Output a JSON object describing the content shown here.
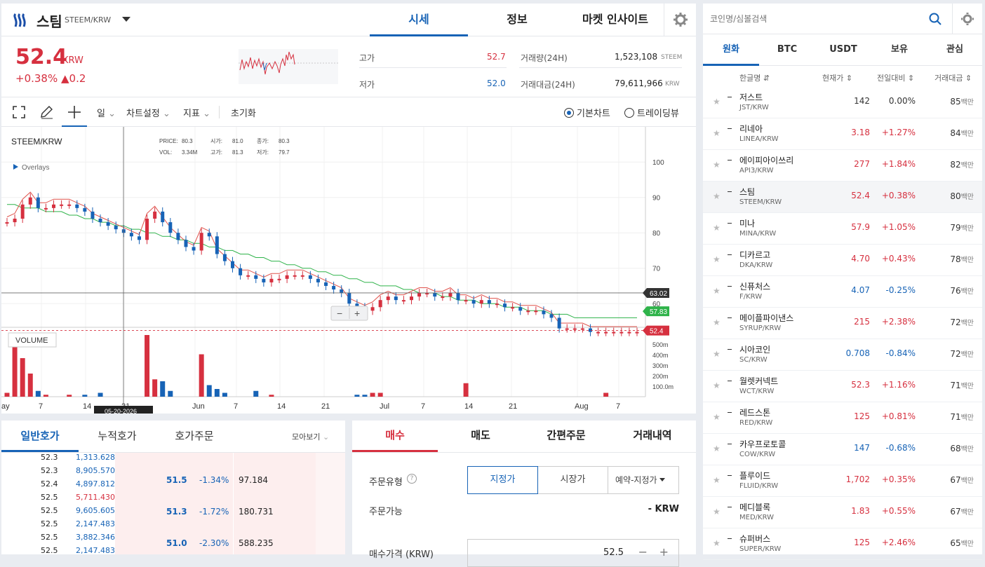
{
  "header": {
    "coin_name": "스팀",
    "pair": "STEEM/KRW",
    "tabs": [
      "시세",
      "정보",
      "마켓 인사이트"
    ]
  },
  "price": {
    "value": "52.4",
    "unit": "KRW",
    "change_pct": "+0.38%",
    "change_abs": "▲0.2",
    "high_label": "고가",
    "high": "52.7",
    "low_label": "저가",
    "low": "52.0",
    "vol_label": "거래량(24H)",
    "vol": "1,523,108",
    "vol_unit": "STEEM",
    "amt_label": "거래대금(24H)",
    "amt": "79,611,966",
    "amt_unit": "KRW"
  },
  "toolbar": {
    "period": "일",
    "settings": "차트설정",
    "indicator": "지표",
    "reset": "초기화",
    "basic_chart": "기본차트",
    "trading_view": "트레이딩뷰"
  },
  "chart_data": {
    "type": "candlestick",
    "title": "STEEM/KRW",
    "overlays_label": "Overlays",
    "info": {
      "PRICE": "80.3",
      "시가": "81.0",
      "종가": "80.3",
      "VOL": "3.34M",
      "고가": "81.3",
      "저가": "79.7"
    },
    "y_ticks": [
      100.0,
      90.0,
      80.0,
      70.0,
      60.0
    ],
    "ylim": [
      50,
      104
    ],
    "vol_ticks": [
      "500m",
      "400m",
      "300m",
      "200m",
      "100.0m"
    ],
    "x_labels": [
      "ay",
      "7",
      "14",
      "21",
      "Jun",
      "7",
      "14",
      "21",
      "Jul",
      "7",
      "14",
      "21",
      "Aug",
      "7"
    ],
    "date_badge": "05-20-2026",
    "volume_label": "VOLUME",
    "price_badges": {
      "crosshair": "63.02",
      "ma": "57.83",
      "current": "52.4"
    },
    "close": [
      83,
      84,
      88,
      90,
      87,
      87,
      88,
      88,
      88,
      87,
      86,
      84,
      83,
      82,
      81,
      80,
      79,
      78,
      84,
      86,
      83,
      80,
      78,
      76,
      75,
      80,
      79,
      74,
      72,
      70,
      68,
      68,
      67,
      66,
      67,
      67,
      68,
      68,
      68,
      67,
      66,
      65,
      64,
      63,
      60,
      59,
      58,
      59,
      61,
      62,
      61,
      61,
      62,
      63,
      63,
      62,
      62,
      63,
      61,
      61,
      60,
      61,
      60,
      60,
      59,
      59,
      58,
      58,
      58,
      57,
      56,
      53,
      53,
      53,
      53,
      52,
      52,
      52,
      52,
      52,
      52,
      52
    ],
    "ma_slow": [
      88,
      88,
      87,
      87,
      87,
      86,
      86,
      86,
      85,
      85,
      84,
      84,
      83,
      83,
      82,
      82,
      81,
      81,
      80,
      80,
      79,
      79,
      78,
      78,
      77,
      77,
      76,
      76,
      75,
      75,
      74,
      74,
      73,
      73,
      72,
      72,
      71,
      71,
      70,
      70,
      69,
      69,
      68,
      68,
      67,
      67,
      66,
      66,
      65,
      65,
      65,
      64,
      64,
      63,
      63,
      63,
      62,
      62,
      61,
      61,
      61,
      60,
      60,
      60,
      59,
      59,
      59,
      58,
      58,
      58,
      57,
      57,
      57,
      56,
      56,
      56,
      56,
      56
    ],
    "volume": [
      10,
      140,
      100,
      60,
      15,
      5,
      0,
      0,
      5,
      0,
      5,
      0,
      10,
      0,
      0,
      0,
      0,
      0,
      160,
      45,
      40,
      15,
      0,
      0,
      0,
      110,
      30,
      20,
      10,
      0,
      0,
      0,
      15,
      0,
      5,
      0,
      0,
      0,
      0,
      0,
      0,
      0,
      0,
      0,
      0,
      5,
      5,
      10,
      10,
      0,
      0,
      0,
      0,
      0,
      0,
      0,
      0,
      0,
      0,
      35,
      0,
      0,
      0,
      0,
      0,
      0,
      0,
      0,
      0,
      0,
      0,
      0,
      0,
      0,
      0,
      0,
      0,
      10,
      0,
      0,
      0
    ]
  },
  "search": {
    "placeholder": "코인명/심볼검색"
  },
  "market_tabs": [
    "원화",
    "BTC",
    "USDT",
    "보유",
    "관심"
  ],
  "market_cols": [
    "한글명 ⇵",
    "현재가 ⇕",
    "전일대비 ⇕",
    "거래대금 ⇕"
  ],
  "markets": [
    {
      "name": "저스트",
      "pair": "JST/KRW",
      "price": "142",
      "chg": "0.00%",
      "vol": "85",
      "dir": "flat"
    },
    {
      "name": "리네아",
      "pair": "LINEA/KRW",
      "price": "3.18",
      "chg": "+1.27%",
      "vol": "84",
      "dir": "up"
    },
    {
      "name": "에이피아이쓰리",
      "pair": "API3/KRW",
      "price": "277",
      "chg": "+1.84%",
      "vol": "82",
      "dir": "up"
    },
    {
      "name": "스팀",
      "pair": "STEEM/KRW",
      "price": "52.4",
      "chg": "+0.38%",
      "vol": "80",
      "dir": "up"
    },
    {
      "name": "미나",
      "pair": "MINA/KRW",
      "price": "57.9",
      "chg": "+1.05%",
      "vol": "79",
      "dir": "up"
    },
    {
      "name": "디카르고",
      "pair": "DKA/KRW",
      "price": "4.70",
      "chg": "+0.43%",
      "vol": "78",
      "dir": "up"
    },
    {
      "name": "신퓨처스",
      "pair": "F/KRW",
      "price": "4.07",
      "chg": "-0.25%",
      "vol": "76",
      "dir": "down"
    },
    {
      "name": "메이플파이낸스",
      "pair": "SYRUP/KRW",
      "price": "215",
      "chg": "+2.38%",
      "vol": "72",
      "dir": "up"
    },
    {
      "name": "시아코인",
      "pair": "SC/KRW",
      "price": "0.708",
      "chg": "-0.84%",
      "vol": "72",
      "dir": "down"
    },
    {
      "name": "월렛커넥트",
      "pair": "WCT/KRW",
      "price": "52.3",
      "chg": "+1.16%",
      "vol": "71",
      "dir": "up"
    },
    {
      "name": "레드스톤",
      "pair": "RED/KRW",
      "price": "125",
      "chg": "+0.81%",
      "vol": "71",
      "dir": "up"
    },
    {
      "name": "카우프로토콜",
      "pair": "COW/KRW",
      "price": "147",
      "chg": "-0.68%",
      "vol": "68",
      "dir": "down"
    },
    {
      "name": "플루이드",
      "pair": "FLUID/KRW",
      "price": "1,702",
      "chg": "+0.35%",
      "vol": "67",
      "dir": "up"
    },
    {
      "name": "메디블록",
      "pair": "MED/KRW",
      "price": "1.83",
      "chg": "+0.55%",
      "vol": "67",
      "dir": "up"
    },
    {
      "name": "슈퍼버스",
      "pair": "SUPER/KRW",
      "price": "125",
      "chg": "+2.46%",
      "vol": "65",
      "dir": "up"
    }
  ],
  "vol_unit": "백만",
  "orderbook": {
    "tabs": [
      "일반호가",
      "누적호가",
      "호가주문"
    ],
    "view": "모아보기",
    "left": [
      [
        "52.3",
        "1,313.628"
      ],
      [
        "52.3",
        "8,905.570"
      ],
      [
        "52.4",
        "4,897.812"
      ],
      [
        "52.5",
        "5,711.430"
      ],
      [
        "52.5",
        "9,605.605"
      ],
      [
        "52.5",
        "2,147.483"
      ],
      [
        "52.5",
        "3,882.346"
      ],
      [
        "52.5",
        "2,147.483"
      ]
    ],
    "asks": [
      [
        "51.5",
        "-1.34%",
        "97.184"
      ],
      [
        "51.3",
        "-1.72%",
        "180.731"
      ],
      [
        "51.0",
        "-2.30%",
        "588.235"
      ]
    ]
  },
  "order": {
    "tabs": [
      "매수",
      "매도",
      "간편주문",
      "거래내역"
    ],
    "type_label": "주문유형",
    "types": [
      "지정가",
      "시장가",
      "예약-지정가"
    ],
    "avail_label": "주문가능",
    "avail_value": "- KRW",
    "price_label": "매수가격 (KRW)",
    "price_value": "52.5"
  }
}
